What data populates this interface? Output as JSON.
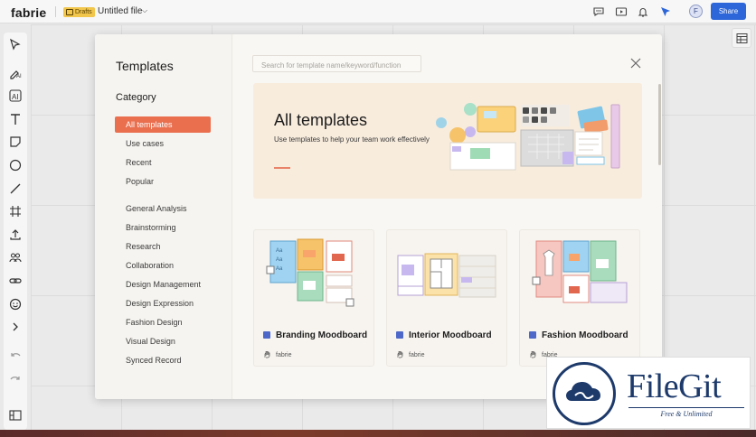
{
  "topbar": {
    "logo": "fabrie",
    "drafts_badge": "Drafts",
    "file_title": "Untitled file",
    "share_label": "Share",
    "avatar_initial": "F",
    "icons": [
      "comment-icon",
      "video-icon",
      "bell-icon",
      "cursor-follow-icon"
    ]
  },
  "toolbar": {
    "tools": [
      "select-tool-icon",
      "ai-brush-icon",
      "ai-text-icon",
      "text-tool-icon",
      "sticky-note-icon",
      "ellipse-tool-icon",
      "line-tool-icon",
      "frame-tool-icon",
      "upload-icon",
      "people-icon",
      "link-icon",
      "emoji-icon",
      "more-chevron-icon",
      "undo-icon",
      "redo-icon",
      "layout-panel-icon"
    ]
  },
  "modal": {
    "title": "Templates",
    "category_heading": "Category",
    "categories_top": [
      "All templates",
      "Use cases",
      "Recent",
      "Popular"
    ],
    "categories": [
      "General Analysis",
      "Brainstorming",
      "Research",
      "Collaboration",
      "Design Management",
      "Design Expression",
      "Fashion Design",
      "Visual Design",
      "Synced Record"
    ],
    "active_category": "All templates",
    "search_placeholder": "Search for template name/keyword/function",
    "banner": {
      "title": "All templates",
      "subtitle": "Use templates to help your team work effectively"
    },
    "cards": [
      {
        "name": "Branding Moodboard",
        "author": "fabrie"
      },
      {
        "name": "Interior Moodboard",
        "author": "fabrie"
      },
      {
        "name": "Fashion Moodboard",
        "author": "fabrie"
      }
    ]
  },
  "watermark": {
    "title": "FileGit",
    "subtitle": "Free & Unlimited"
  },
  "colors": {
    "accent": "#e96f4f",
    "share": "#2d66d8",
    "banner_bg": "#f8ecdd",
    "drafts": "#f2c64b"
  }
}
